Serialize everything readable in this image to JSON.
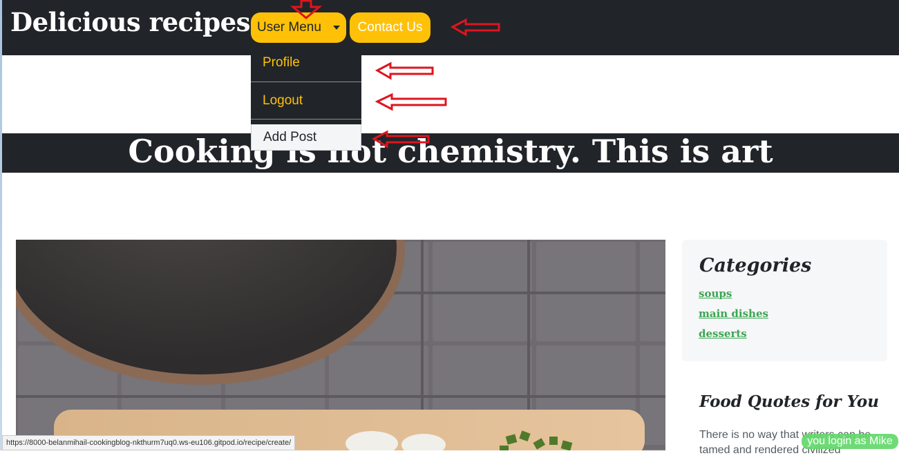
{
  "navbar": {
    "brand": "Delicious recipes",
    "user_menu_label": "User Menu",
    "contact_label": "Contact Us"
  },
  "dropdown": {
    "items": [
      {
        "label": "Profile"
      },
      {
        "label": "Logout"
      },
      {
        "label": "Add Post"
      }
    ]
  },
  "banner": {
    "text": "Cooking is not chemistry. This is art"
  },
  "sidebar": {
    "categories_title": "Categories",
    "categories": [
      "soups",
      "main dishes",
      "desserts"
    ],
    "quotes_title": "Food Quotes for You",
    "quote_text": "There is no way that writers can be tamed and rendered civilized"
  },
  "status_bar": {
    "url": "https://8000-belanmihail-cookingblog-nkthurm7uq0.ws-eu106.gitpod.io/recipe/create/"
  },
  "login_badge": "you login as Mike",
  "colors": {
    "navbar_bg": "#212529",
    "accent_yellow": "#ffc107",
    "link_green": "#3aa652",
    "annotation_red": "#e0141e"
  },
  "icons": [
    "caret-down-icon",
    "red-arrow-annotation"
  ]
}
